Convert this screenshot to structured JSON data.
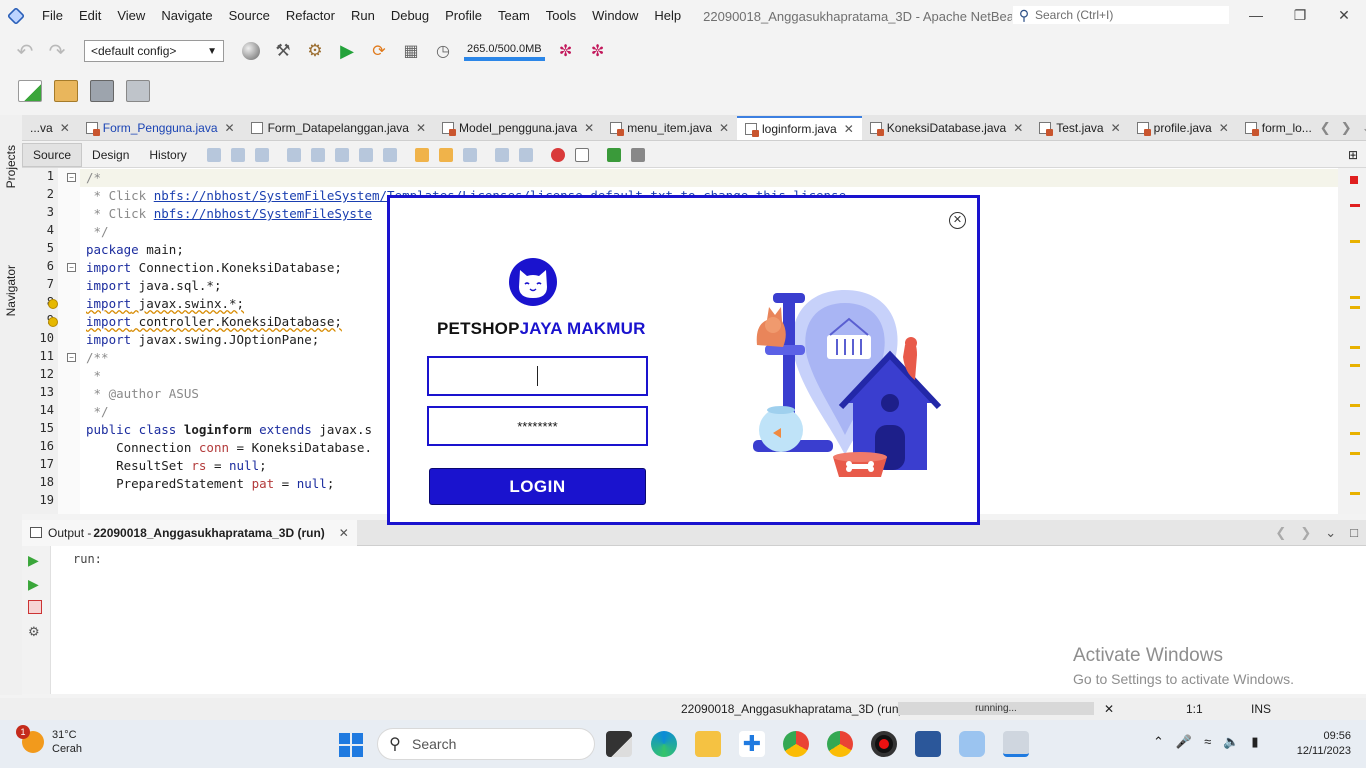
{
  "menubar": {
    "items": [
      "File",
      "Edit",
      "View",
      "Navigate",
      "Source",
      "Refactor",
      "Run",
      "Debug",
      "Profile",
      "Team",
      "Tools",
      "Window",
      "Help"
    ],
    "title": "22090018_Anggasukhapratama_3D - Apache NetBeans IDE 16",
    "search_placeholder": "Search (Ctrl+I)"
  },
  "toolbar": {
    "config": "<default config>",
    "memory": "265.0/500.0MB"
  },
  "side": {
    "projects": "Projects",
    "navigator": "Navigator"
  },
  "tabs": [
    {
      "label": "...va",
      "modified": false
    },
    {
      "label": "Form_Pengguna.java",
      "modified": true
    },
    {
      "label": "Form_Datapelanggan.java",
      "modified": false
    },
    {
      "label": "Model_pengguna.java",
      "modified": false
    },
    {
      "label": "menu_item.java",
      "modified": false
    },
    {
      "label": "loginform.java",
      "modified": false,
      "active": true
    },
    {
      "label": "KoneksiDatabase.java",
      "modified": false
    },
    {
      "label": "Test.java",
      "modified": false
    },
    {
      "label": "profile.java",
      "modified": false
    },
    {
      "label": "form_lo...",
      "modified": false
    }
  ],
  "editor_tabs": {
    "source": "Source",
    "design": "Design",
    "history": "History"
  },
  "code": {
    "line_numbers": [
      "1",
      "2",
      "3",
      "4",
      "5",
      "6",
      "7",
      "8",
      "9",
      "10",
      "11",
      "12",
      "13",
      "14",
      "15",
      "16",
      "17",
      "18",
      "19"
    ],
    "l1": "/*",
    "l2_pre": " * Click ",
    "l2_link": "nbfs://nbhost/SystemFileSystem/Templates/Licenses/license-default.txt to change this license",
    "l3_pre": " * Click ",
    "l3_link": "nbfs://nbhost/SystemFileSyste",
    "l4": " */",
    "l5_kw": "package",
    "l5_rest": " main;",
    "l6_kw": "import",
    "l6_rest": " Connection.KoneksiDatabase;",
    "l7_kw": "import",
    "l7_rest": " java.sql.*;",
    "l8_kw": "import",
    "l8_rest": " javax.swinx.*;",
    "l9_kw": "import",
    "l9_rest": " controller.KoneksiDatabase;",
    "l10_kw": "import",
    "l10_rest": " javax.swing.JOptionPane;",
    "l11": "/**",
    "l12": " *",
    "l13": " * @author ASUS",
    "l14": " */",
    "l15_kw1": "public class",
    "l15_name": " loginform ",
    "l15_kw2": "extends",
    "l15_rest": " javax.s",
    "l16_a": "    Connection ",
    "l16_var": "conn",
    "l16_b": " = KoneksiDatabase.",
    "l17_a": "    ResultSet ",
    "l17_var": "rs",
    "l17_b": " = ",
    "l17_kw": "null",
    "l17_c": ";",
    "l18_a": "    PreparedStatement ",
    "l18_var": "pat",
    "l18_b": " = ",
    "l18_kw": "null",
    "l18_c": ";"
  },
  "output": {
    "label": "Output - ",
    "project": "22090018_Anggasukhapratama_3D (run)",
    "text": "run:"
  },
  "watermark": {
    "line1": "Activate Windows",
    "line2": "Go to Settings to activate Windows."
  },
  "status": {
    "project": "22090018_Anggasukhapratama_3D (run)",
    "progress": "running...",
    "position": "1:1",
    "mode": "INS"
  },
  "taskbar": {
    "weather_badge": "1",
    "temp": "31°C",
    "condition": "Cerah",
    "search": "Search",
    "time": "09:56",
    "date": "12/11/2023"
  },
  "login": {
    "brand_part1": "PETSHOP",
    "brand_part2": "JAYA MAKMUR",
    "username_value": "",
    "password_value": "********",
    "button": "LOGIN",
    "accent": "#1a13ce"
  }
}
